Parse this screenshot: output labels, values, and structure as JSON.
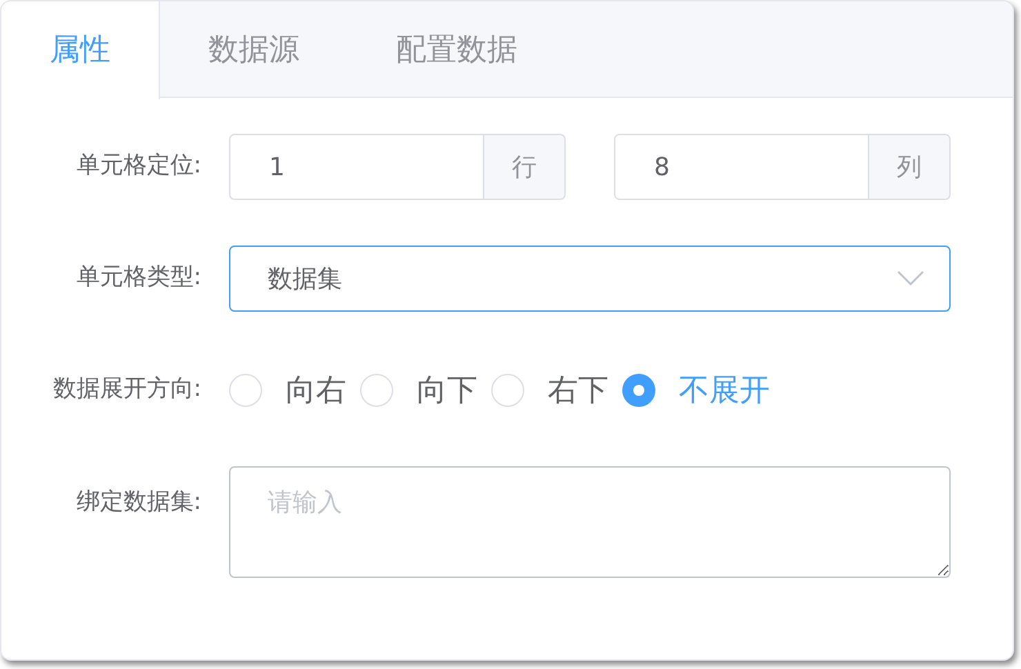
{
  "tabs": [
    {
      "label": "属性",
      "selected": true
    },
    {
      "label": "数据源",
      "selected": false
    },
    {
      "label": "配置数据",
      "selected": false
    }
  ],
  "form": {
    "cell_position": {
      "label": "单元格定位:",
      "row_value": "1",
      "row_suffix": "行",
      "column_value": "8",
      "column_suffix": "列"
    },
    "cell_type": {
      "label": "单元格类型:",
      "value": "数据集"
    },
    "expand_direction": {
      "label": "数据展开方向:",
      "options": [
        {
          "label": "向右",
          "selected": false
        },
        {
          "label": "向下",
          "selected": false
        },
        {
          "label": "右下",
          "selected": false
        },
        {
          "label": "不展开",
          "selected": true
        }
      ]
    },
    "bind_dataset": {
      "label": "绑定数据集:",
      "placeholder": "请输入"
    }
  }
}
